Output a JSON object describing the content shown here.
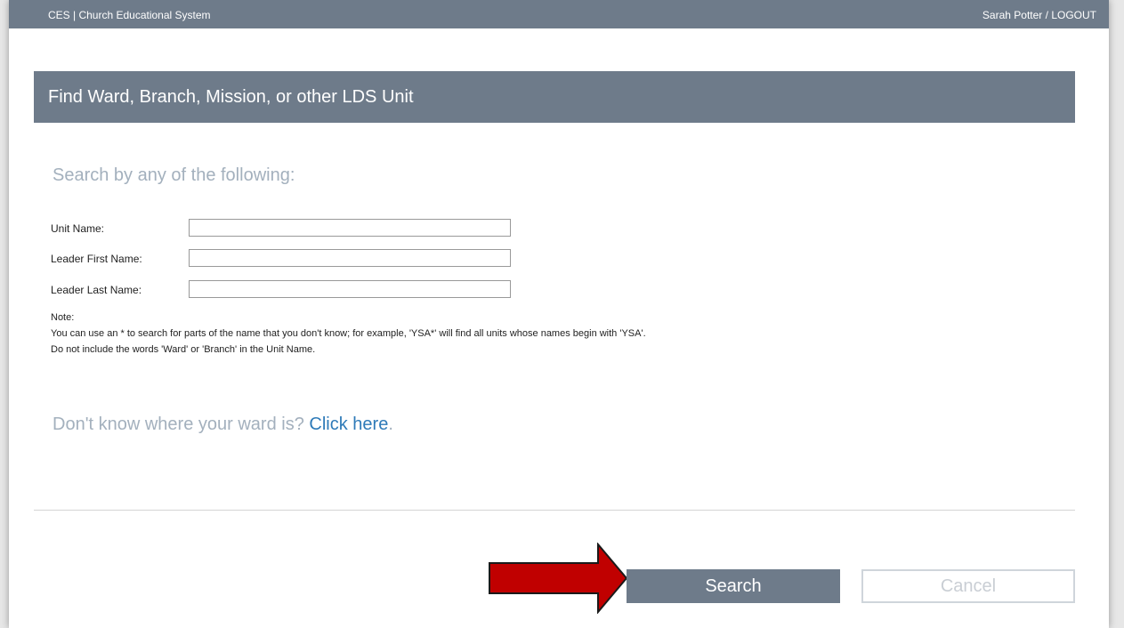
{
  "topbar": {
    "brand": "CES | Church Educational System",
    "user_name": "Sarah Potter",
    "separator": "/",
    "logout": "LOGOUT"
  },
  "panel": {
    "title": "Find Ward, Branch, Mission, or other LDS Unit"
  },
  "search": {
    "heading": "Search by any of the following:",
    "fields": [
      {
        "label": "Unit Name:",
        "value": ""
      },
      {
        "label": "Leader First Name:",
        "value": ""
      },
      {
        "label": "Leader Last Name:",
        "value": ""
      }
    ]
  },
  "note": {
    "label": "Note:",
    "line1": "You can use an * to search for parts of the name that you don't know; for example, 'YSA*' will find all units whose names begin with 'YSA'.",
    "line2": "Do not include the words 'Ward' or 'Branch' in the Unit Name."
  },
  "ward_help": {
    "text": "Don't know where your ward is?",
    "link": "Click here",
    "end": "."
  },
  "actions": {
    "search_label": "Search",
    "cancel_label": "Cancel"
  },
  "colors": {
    "header_bg": "#6e7b8a",
    "muted_text": "#a3b0bd",
    "link": "#2e7ab8",
    "arrow": "#c00000"
  },
  "icons": {
    "annotation_arrow": "red-arrow-right-icon"
  }
}
